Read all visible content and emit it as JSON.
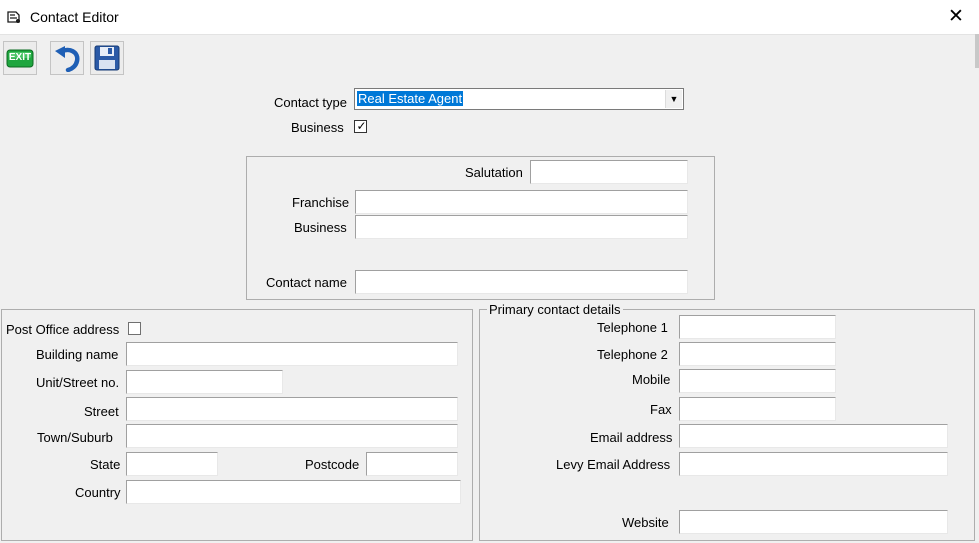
{
  "window": {
    "title": "Contact Editor",
    "close_glyph": "✕"
  },
  "toolbar": {
    "exit_label": "EXIT",
    "exit_color": "#22b14c",
    "undo_color": "#3a78c6",
    "save_color": "#2f5fa8"
  },
  "contact": {
    "type_label": "Contact type",
    "type_value": "Real Estate Agent",
    "business_label": "Business",
    "business_checked": true,
    "check_glyph": "✓"
  },
  "name_group": {
    "salutation_label": "Salutation",
    "salutation_value": "",
    "franchise_label": "Franchise",
    "franchise_value": "",
    "business_label": "Business",
    "business_value": "",
    "contact_name_label": "Contact name",
    "contact_name_value": ""
  },
  "address": {
    "po_label": "Post Office address",
    "po_checked": false,
    "building_label": "Building name",
    "building_value": "",
    "unit_label": "Unit/Street no.",
    "unit_value": "",
    "street_label": "Street",
    "street_value": "",
    "town_label": "Town/Suburb",
    "town_value": "",
    "state_label": "State",
    "state_value": "",
    "postcode_label": "Postcode",
    "postcode_value": "",
    "country_label": "Country",
    "country_value": ""
  },
  "primary": {
    "legend": "Primary contact details",
    "tel1_label": "Telephone 1",
    "tel1_value": "",
    "tel2_label": "Telephone 2",
    "tel2_value": "",
    "mobile_label": "Mobile",
    "mobile_value": "",
    "fax_label": "Fax",
    "fax_value": "",
    "email_label": "Email address",
    "email_value": "",
    "levy_label": "Levy Email Address",
    "levy_value": "",
    "website_label": "Website",
    "website_value": ""
  }
}
